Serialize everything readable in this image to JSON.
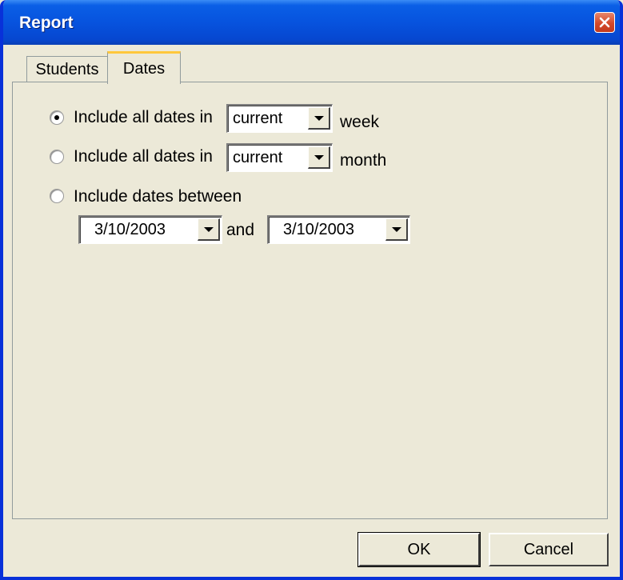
{
  "window": {
    "title": "Report"
  },
  "tabs": [
    {
      "label": "Students"
    },
    {
      "label": "Dates"
    }
  ],
  "active_tab": "Dates",
  "options": {
    "week": {
      "label": "Include all dates in",
      "selected": true,
      "period": "current",
      "unit": "week"
    },
    "month": {
      "label": "Include all dates in",
      "selected": false,
      "period": "current",
      "unit": "month"
    },
    "range": {
      "label": "Include dates between",
      "selected": false,
      "start": "3/10/2003",
      "joiner": "and",
      "end": "3/10/2003"
    }
  },
  "buttons": {
    "ok": "OK",
    "cancel": "Cancel"
  },
  "colors": {
    "titlebar": "#0753de",
    "face": "#ece9d8",
    "tab_highlight": "#ffc83c",
    "close": "#d4492a"
  }
}
